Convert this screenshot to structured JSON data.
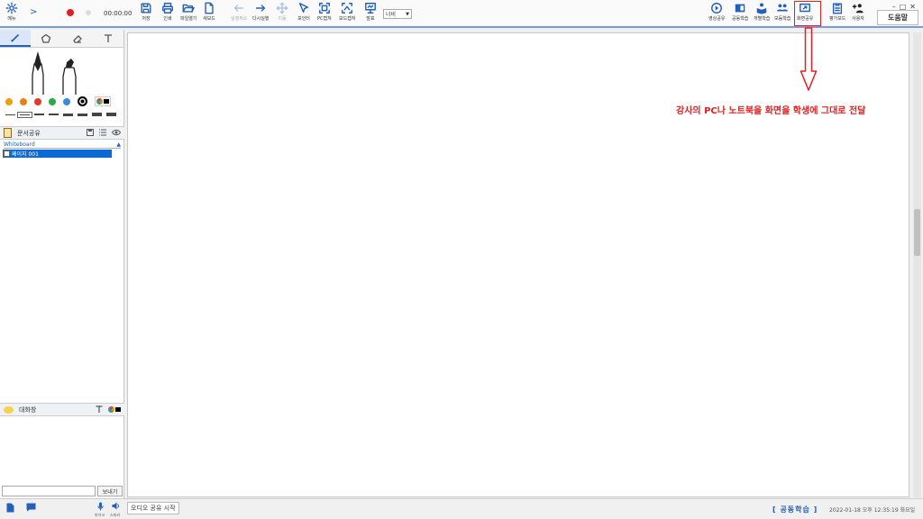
{
  "toolbar": {
    "menu_label": "메뉴",
    "timer": "00:00:00",
    "buttons": {
      "save": "저장",
      "print": "인쇄",
      "open_file": "파일열기",
      "new_board": "새보드",
      "undo": "실행취소",
      "redo": "다시실행",
      "move": "이동",
      "pointer": "포인터",
      "pc_capture": "PC캡쳐",
      "board_capture": "보드캡쳐",
      "presentation": "발표",
      "video_share": "영상공유",
      "group_learning": "공동학습",
      "individual_learning": "개별학습",
      "mode_learning": "모둠학습",
      "screen_share": "화면공유",
      "evaluation": "평가모드",
      "users": "사용자"
    },
    "width_select": "너비",
    "help": "도움말"
  },
  "tools": {
    "colors": [
      "#f0a000",
      "#e8801a",
      "#e23a2a",
      "#2aa84a",
      "#3a8ae0",
      "#000000"
    ]
  },
  "docs": {
    "title": "문서공유",
    "whiteboard": "Whiteboard",
    "page_item": "페이지 001"
  },
  "chat": {
    "title": "대화창",
    "send": "보내기"
  },
  "annotation": {
    "text": "강사의 PC나 노트북을 화면을 학생에 그대로 전달",
    "color": "#e02020"
  },
  "status": {
    "mic_label": "마이크",
    "speaker_label": "스피커",
    "audio_share": "오디오 공유 시작",
    "mode": "[ 공동학습 ]",
    "datetime": "2022-01-18 오후 12:35:19 화요일"
  },
  "colors": {
    "accent": "#2460b8",
    "selection": "#0a6ad6"
  }
}
